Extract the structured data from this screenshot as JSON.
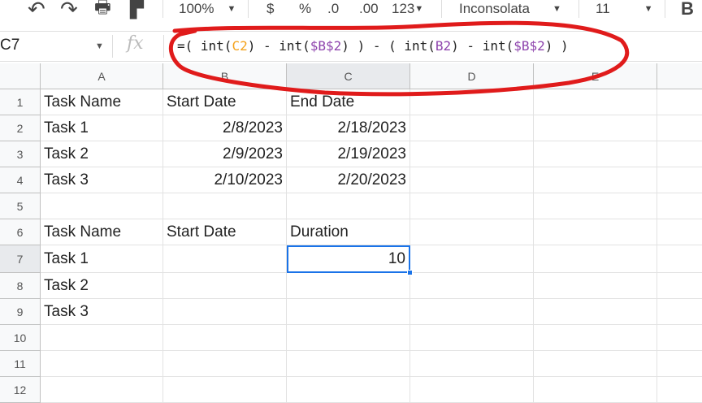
{
  "toolbar": {
    "zoom": "100%",
    "currency": "$",
    "percent": "%",
    "dec_less": ".0",
    "dec_more": ".00",
    "format": "123",
    "font": "Inconsolata",
    "font_size": "11",
    "bold": "B"
  },
  "formula_bar": {
    "name_box": "C7",
    "fx": "fx",
    "formula_parts": [
      "=( int(",
      "C2",
      ") - int(",
      "$B$2",
      ") ) - ( int(",
      "B2",
      ") - int(",
      "$B$2",
      ") )"
    ]
  },
  "columns": [
    "A",
    "B",
    "C",
    "D",
    "E"
  ],
  "rows": [
    "1",
    "2",
    "3",
    "4",
    "5",
    "6",
    "7",
    "8",
    "9",
    "10",
    "11",
    "12"
  ],
  "cells": [
    [
      "Task Name",
      "Start Date",
      "End Date",
      "",
      ""
    ],
    [
      "Task 1",
      "2/8/2023",
      "2/18/2023",
      "",
      ""
    ],
    [
      "Task 2",
      "2/9/2023",
      "2/19/2023",
      "",
      ""
    ],
    [
      "Task 3",
      "2/10/2023",
      "2/20/2023",
      "",
      ""
    ],
    [
      "",
      "",
      "",
      "",
      ""
    ],
    [
      "Task Name",
      "Start Date",
      "Duration",
      "",
      ""
    ],
    [
      "Task 1",
      "",
      "10",
      "",
      ""
    ],
    [
      "Task 2",
      "",
      "",
      "",
      ""
    ],
    [
      "Task 3",
      "",
      "",
      "",
      ""
    ],
    [
      "",
      "",
      "",
      "",
      ""
    ],
    [
      "",
      "",
      "",
      "",
      ""
    ],
    [
      "",
      "",
      "",
      "",
      ""
    ]
  ],
  "colors": {
    "ref1": "#f4a21b",
    "ref2": "#8e44ad",
    "selection": "#1a73e8",
    "annotation": "#e01b1b"
  }
}
